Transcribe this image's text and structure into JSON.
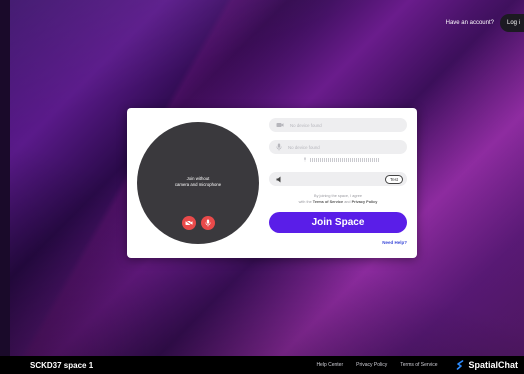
{
  "header": {
    "have_account": "Have an account?",
    "login": "Log i"
  },
  "card": {
    "preview_text_line1": "Join without",
    "preview_text_line2": "camera and microphone",
    "camera_field": "No device found",
    "mic_field": "No device found",
    "test_label": "Test",
    "terms_line1": "By joining the space, I agree",
    "terms_prefix": "with the",
    "terms_tos": "Terms of Service",
    "terms_and": "and",
    "terms_privacy": "Privacy Policy",
    "join_label": "Join Space",
    "need_help": "Need Help?"
  },
  "footer": {
    "space_name": "SCKD37 space 1",
    "links": [
      "Help Center",
      "Privacy Policy",
      "Terms of Service"
    ],
    "brand": "SpatialChat"
  },
  "colors": {
    "accent": "#5a1ee8",
    "danger": "#e94a4a",
    "link": "#3c4bd9"
  }
}
